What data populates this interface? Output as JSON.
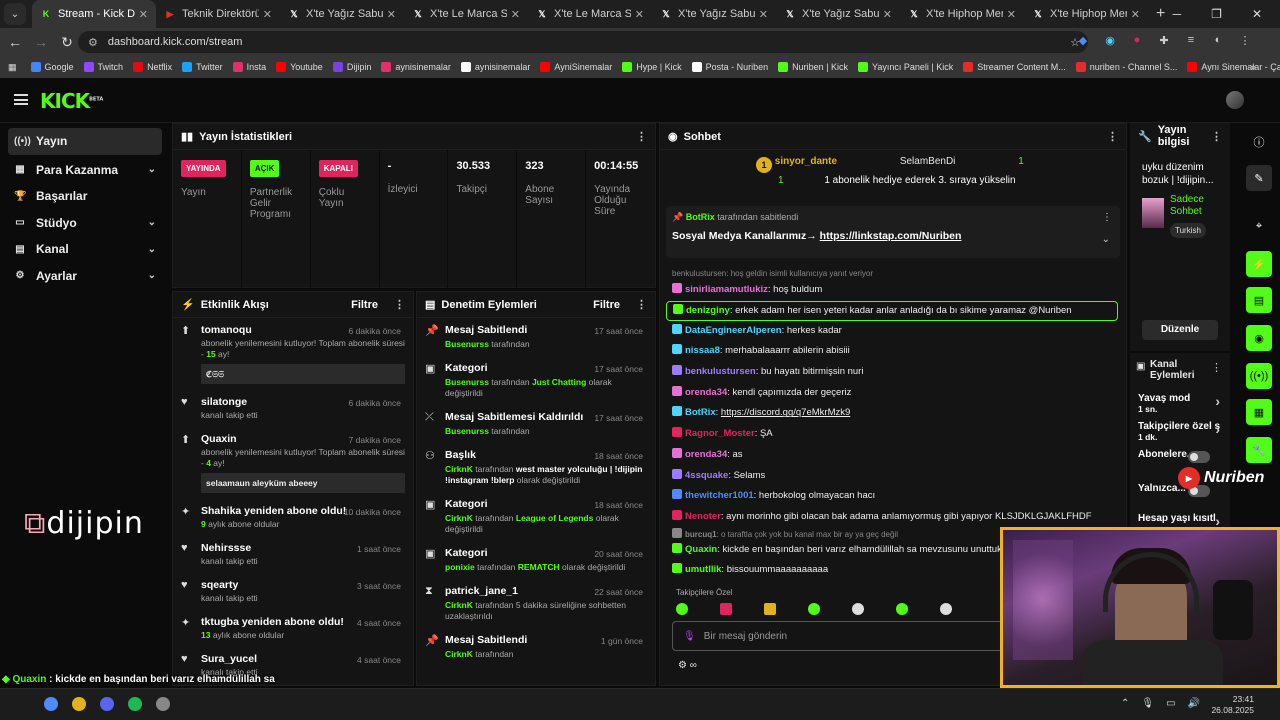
{
  "browser": {
    "tabs": [
      {
        "title": "Stream - Kick Dashboard",
        "fav": "K",
        "favColor": "#53fc18",
        "active": true
      },
      {
        "title": "Teknik Direktörümüz",
        "fav": "▶",
        "favColor": "#e52d27"
      },
      {
        "title": "X'te Yağız Sabuncuoğ",
        "fav": "𝕏",
        "favColor": "#ffffff"
      },
      {
        "title": "X'te Le Marca Sports",
        "fav": "𝕏",
        "favColor": "#ffffff"
      },
      {
        "title": "X'te Le Marca Sports",
        "fav": "𝕏",
        "favColor": "#ffffff"
      },
      {
        "title": "X'te Yağız Sabuncuoğ",
        "fav": "𝕏",
        "favColor": "#ffffff"
      },
      {
        "title": "X'te Yağız Sabuncuoğ",
        "fav": "𝕏",
        "favColor": "#ffffff"
      },
      {
        "title": "X'te Hiphop Merkezi",
        "fav": "𝕏",
        "favColor": "#ffffff"
      },
      {
        "title": "X'te Hiphop Merkezi",
        "fav": "𝕏",
        "favColor": "#ffffff"
      }
    ],
    "url": "dashboard.kick.com/stream",
    "bookmarks": [
      {
        "label": "Google",
        "color": "#4285f4"
      },
      {
        "label": "Twitch",
        "color": "#9146ff"
      },
      {
        "label": "Netflix",
        "color": "#e50914"
      },
      {
        "label": "Twitter",
        "color": "#1da1f2"
      },
      {
        "label": "Insta",
        "color": "#e1306c"
      },
      {
        "label": "Youtube",
        "color": "#ff0000"
      },
      {
        "label": "Dijipin",
        "color": "#7b3fe4"
      },
      {
        "label": "aynisinemalar",
        "color": "#e1306c"
      },
      {
        "label": "aynisinemalar",
        "color": "#ffffff"
      },
      {
        "label": "AyniSinemalar",
        "color": "#ff0000"
      },
      {
        "label": "Hype | Kick",
        "color": "#53fc18"
      },
      {
        "label": "Posta - Nuriben",
        "color": "#ffffff"
      },
      {
        "label": "Nuriben | Kick",
        "color": "#53fc18"
      },
      {
        "label": "Yayıncı Paneli | Kick",
        "color": "#53fc18"
      },
      {
        "label": "Streamer Content M...",
        "color": "#e52d27"
      },
      {
        "label": "nuriben - Channel S...",
        "color": "#e52d27"
      },
      {
        "label": "Aynı Sinemalar - Ça...",
        "color": "#ff0000"
      }
    ]
  },
  "sidebar": {
    "items": [
      {
        "label": "Yayın",
        "icon": "((•))",
        "active": true
      },
      {
        "label": "Para Kazanma",
        "icon": "▦",
        "chev": "⌄"
      },
      {
        "label": "Başarılar",
        "icon": "🏆"
      },
      {
        "label": "Stüdyo",
        "icon": "▭",
        "chev": "⌄"
      },
      {
        "label": "Kanal",
        "icon": "▤",
        "chev": "⌄"
      },
      {
        "label": "Ayarlar",
        "icon": "⚙",
        "chev": "⌄"
      }
    ],
    "brand": "dijipin"
  },
  "stats": {
    "title": "Yayın İstatistikleri",
    "items": [
      {
        "badge": "YAYINDA",
        "badgeColor": "#e0245e",
        "val": "",
        "label": "Yayın"
      },
      {
        "badge": "AÇIK",
        "badgeColor": "#53fc18",
        "val": "",
        "label": "Partnerlik Gelir Programı"
      },
      {
        "badge": "KAPALI",
        "badgeColor": "#e0245e",
        "val": "",
        "label": "Çoklu Yayın"
      },
      {
        "badge": "",
        "val": "-",
        "label": "İzleyici"
      },
      {
        "badge": "",
        "val": "30.533",
        "label": "Takipçi"
      },
      {
        "badge": "",
        "val": "323",
        "label": "Abone Sayısı"
      },
      {
        "badge": "",
        "val": "00:14:55",
        "label": "Yayında Olduğu Süre"
      }
    ]
  },
  "activity": {
    "title": "Etkinlik Akışı",
    "filter": "Filtre",
    "items": [
      {
        "icon": "⬆",
        "name": "tomanoqu",
        "time": "6 dakika önce",
        "sub": "abonelik yenilemesini kutluyor! Toplam abonelik süresi - ",
        "subB": "15",
        "subE": " ay!",
        "box": "ℭ𝔖𝔖"
      },
      {
        "icon": "♥",
        "name": "silatonge",
        "time": "6 dakika önce",
        "sub": "kanalı takip etti"
      },
      {
        "icon": "⬆",
        "name": "Quaxin",
        "time": "7 dakika önce",
        "sub": "abonelik yenilemesini kutluyor! Toplam abonelik süresi - ",
        "subB": "4",
        "subE": " ay!",
        "box": "selaamaun aleyküm abeeey"
      },
      {
        "icon": "✦",
        "name": "Shahika yeniden abone oldu!",
        "time": "10 dakika önce",
        "subB": "9",
        "subE": " aylık abone oldular"
      },
      {
        "icon": "♥",
        "name": "Nehirssse",
        "time": "1 saat önce",
        "sub": "kanalı takip etti"
      },
      {
        "icon": "♥",
        "name": "sqearty",
        "time": "3 saat önce",
        "sub": "kanalı takip etti"
      },
      {
        "icon": "✦",
        "name": "tktugba yeniden abone oldu!",
        "time": "4 saat önce",
        "subB": "13",
        "subE": " aylık abone oldular"
      },
      {
        "icon": "♥",
        "name": "Sura_yucel",
        "time": "4 saat önce",
        "sub": "kanalı takip etti"
      }
    ]
  },
  "moderation": {
    "title": "Denetim Eylemleri",
    "filter": "Filtre",
    "items": [
      {
        "icon": "📌",
        "name": "Mesaj Sabitlendi",
        "time": "17 saat önce",
        "u": "Busenurss",
        "rest": " tarafından"
      },
      {
        "icon": "▣",
        "name": "Kategori",
        "time": "17 saat önce",
        "u": "Busenurss",
        "rest": " tarafından ",
        "g2": "Just Chatting",
        "rest2": " olarak değiştirildi"
      },
      {
        "icon": "⤫",
        "name": "Mesaj Sabitlemesi Kaldırıldı",
        "time": "17 saat önce",
        "u": "Busenurss",
        "rest": " tarafından"
      },
      {
        "icon": "⚇",
        "name": "Başlık",
        "time": "18 saat önce",
        "u": "CirknK",
        "rest": " tarafından ",
        "w2": "west master yolculuğu | !dijipin !instagram !blerp",
        "rest2": " olarak değiştirildi"
      },
      {
        "icon": "▣",
        "name": "Kategori",
        "time": "18 saat önce",
        "u": "CirknK",
        "rest": " tarafından ",
        "g2": "League of Legends",
        "rest2": "  olarak değiştirildi"
      },
      {
        "icon": "▣",
        "name": "Kategori",
        "time": "20 saat önce",
        "u": "ponixie",
        "rest": " tarafından ",
        "g2": "REMATCH",
        "rest2": " olarak değiştirildi"
      },
      {
        "icon": "⧗",
        "name": "patrick_jane_1",
        "time": "22 saat önce",
        "u": "CirknK",
        "rest": " tarafından 5 dakika süreliğine sohbetten uzaklaştırıldı"
      },
      {
        "icon": "📌",
        "name": "Mesaj Sabitlendi",
        "time": "1 gün önce",
        "u": "CirknK",
        "rest": " tarafından"
      }
    ]
  },
  "chat": {
    "title": "Sohbet",
    "gift_user": "sinyor_dante",
    "gift_count": "1",
    "gift_other": "SelamBenDi",
    "gift_other_count": "1",
    "gift_text": "1 abonelik hediye ederek 3. sıraya yükselin",
    "pinned_by": "BotRix",
    "pinned_by_suffix": "tarafından sabitlendi",
    "pinned_text": "Sosyal Medya Kanallarımız→ ",
    "pinned_link": "https://linkstap.com/Nuriben",
    "reply_note": "benkulustursen: hoş geldin isimli kullanıcıya yanıt veriyor",
    "messages": [
      {
        "user": "sinirliamamutlukiz",
        "color": "#e86fd3",
        "text": ": hoş buldum"
      },
      {
        "user": "denizginy",
        "color": "#53fc18",
        "text": ": erkek adam her isen yeteri kadar anlar anladığı da bı sikime yaramaz @Nuriben",
        "hl": true
      },
      {
        "user": "DataEngineerAlperen",
        "color": "#4fd3ff",
        "text": ": herkes kadar"
      },
      {
        "user": "nissaa8",
        "color": "#4fd3ff",
        "text": ": merhabalaaarrr abilerin abisiii"
      },
      {
        "user": "benkulustursen",
        "color": "#9f7cff",
        "text": ": bu hayatı bitirmişsin nuri"
      },
      {
        "user": "orenda34",
        "color": "#e86fd3",
        "text": ": kendi çapımızda der geçeriz"
      },
      {
        "user": "BotRix",
        "color": "#4fd3ff",
        "text": ": ",
        "link": "https://discord.gg/q7eMkrMzk9"
      },
      {
        "user": "Ragnor_Moster",
        "color": "#e0245e",
        "text": ": ŞA"
      },
      {
        "user": "orenda34",
        "color": "#e86fd3",
        "text": ": as"
      },
      {
        "user": "4ssquake",
        "color": "#9f7cff",
        "text": ": Selams"
      },
      {
        "user": "thewitcher1001",
        "color": "#4f8bff",
        "text": ": herbokolog olmayacan hacı"
      },
      {
        "user": "Nenoter",
        "color": "#e0245e",
        "text": ": aynı morinho gibi olacan bak adama anlamıyormuş gibi yapıyor KLSJDKLGJAKLFHDF"
      },
      {
        "user": "burcuq1",
        "color": "#888888",
        "text": ": o taraftla çok yok bu kanal max bir ay ya geç değil",
        "small": true
      },
      {
        "user": "Quaxin",
        "color": "#53fc18",
        "text": ": kickde en başından beri varız elhamdülillah sa mevzusunu unuttuk herh"
      },
      {
        "user": "umutllik",
        "color": "#53fc18",
        "text": ": bissouummaaaaaaaaaa"
      }
    ],
    "emote_label": "Takipçilere Özel",
    "input_placeholder": "Bir mesaj gönderin"
  },
  "stream_info": {
    "title": "Yayın bilgisi",
    "stream_title": "uyku düzenim bozuk | !dijipin...",
    "category": "Sadece Sohbet",
    "tag": "Turkish",
    "edit": "Düzenle"
  },
  "mod_actions": {
    "title": "Kanal Eylemleri",
    "items": [
      {
        "label": "Yavaş mod",
        "val": "1 sn."
      },
      {
        "label": "Takipçilere özel s",
        "val": "1 dk."
      },
      {
        "label": "Abonelere...",
        "val": ""
      },
      {
        "label": "Yalnızca...",
        "val": ""
      },
      {
        "label": "Hesap yaşı kısıtl",
        "val": ""
      }
    ]
  },
  "overlay": {
    "user": "Quaxin",
    "text": " : kickde en başından beri varız elhamdülillah sa mevzusunu unuttuk herhalde",
    "line3": "uummaaaaaaaaaa"
  },
  "watermark": "Nuriben",
  "clock": {
    "time": "23:41",
    "date": "26.08.2025"
  }
}
